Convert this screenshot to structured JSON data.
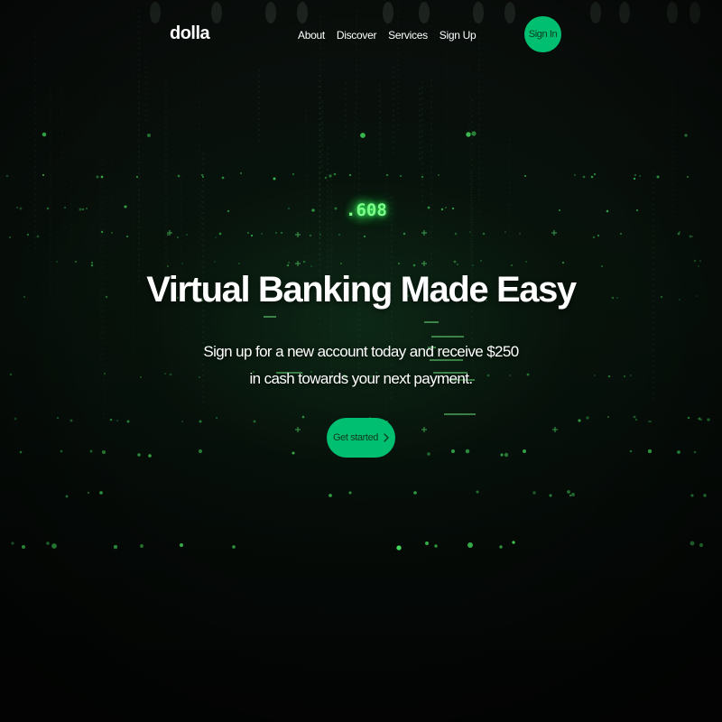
{
  "navbar": {
    "logo": "dolla",
    "links": [
      {
        "label": "About"
      },
      {
        "label": "Discover"
      },
      {
        "label": "Services"
      },
      {
        "label": "Sign Up"
      }
    ],
    "signin_label": "Sign In"
  },
  "hero": {
    "counter_text": ".608",
    "title": "Virtual Banking Made Easy",
    "subtitle_line1": "Sign up for a new account today and receive $250",
    "subtitle_line2": "in cash towards your next payment.",
    "cta_label": "Get started",
    "cta_icon": "chevron-right-icon"
  },
  "colors": {
    "accent": "#01bf71",
    "background": "#050806",
    "glow_green": "#35ff5c"
  }
}
